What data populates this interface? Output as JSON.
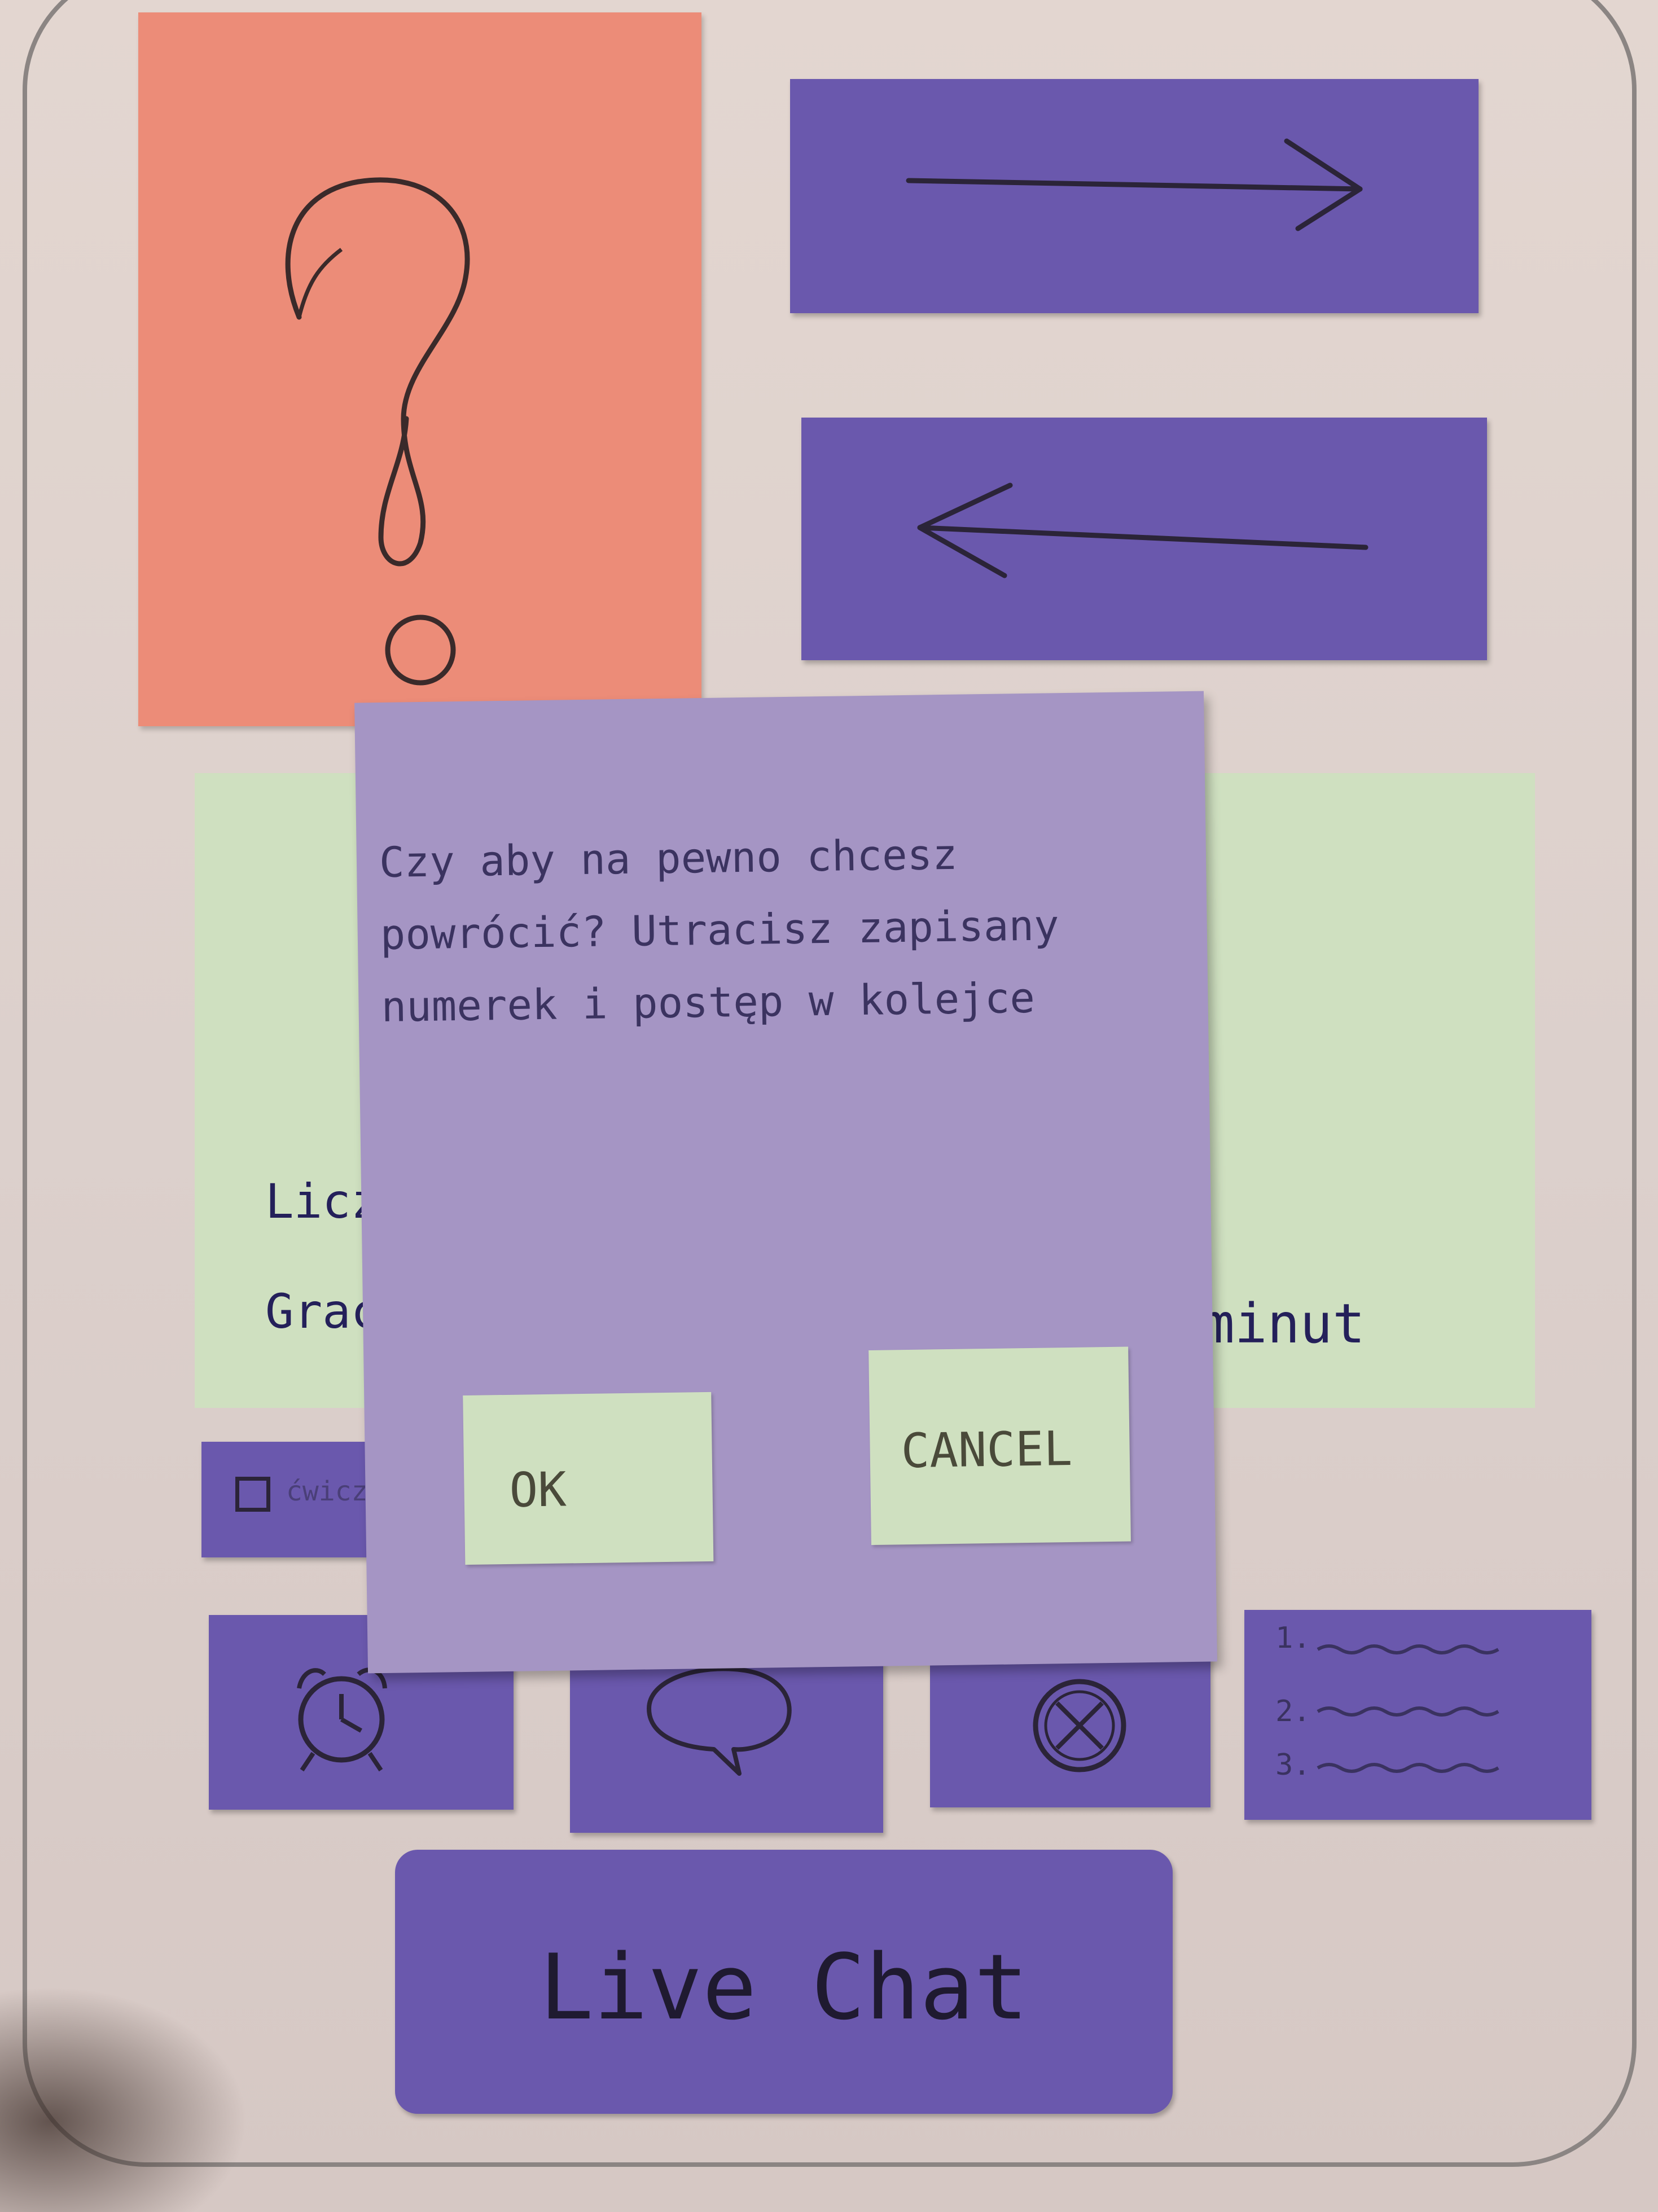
{
  "help_card": {
    "icon": "question-mark-icon"
  },
  "nav": {
    "forward_icon": "arrow-right-icon",
    "back_icon": "arrow-left-icon"
  },
  "stats": {
    "line1": "Liczba",
    "line2": "Gracz",
    "line2_end": "minut"
  },
  "checkbox_strip": {
    "label": "ćwicz"
  },
  "dialog": {
    "message": "Czy aby na pewno chcesz powrócić? Utracisz zapisany numerek i postęp w kolejce",
    "ok_label": "OK",
    "cancel_label": "CANCEL"
  },
  "toolbar": [
    {
      "name": "alarm-clock-button",
      "icon": "alarm-clock-icon"
    },
    {
      "name": "speech-bubble-button",
      "icon": "speech-bubble-icon"
    },
    {
      "name": "cancel-circle-button",
      "icon": "x-circle-icon"
    },
    {
      "name": "queue-list-button",
      "icon": "numbered-list-icon",
      "items": [
        "1.",
        "2.",
        "3."
      ]
    }
  ],
  "live_chat": {
    "label": "Live Chat"
  },
  "colors": {
    "purple": "#6a58ad",
    "dialog_purple": "#a595c4",
    "green": "#cfe0c0",
    "salmon": "#ec8c78",
    "paper": "#e0d4cf"
  }
}
